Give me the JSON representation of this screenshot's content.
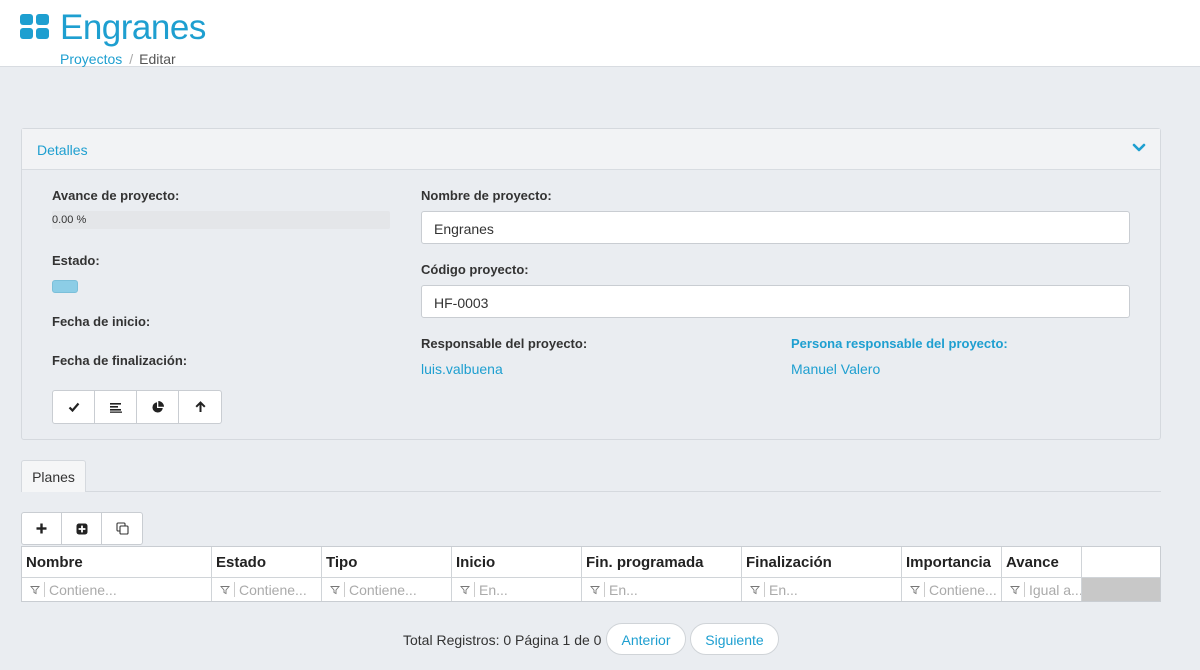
{
  "header": {
    "title": "Engranes",
    "breadcrumb": {
      "link": "Proyectos",
      "separator": "/",
      "current": "Editar"
    }
  },
  "details": {
    "panel_title": "Detalles",
    "avance_label": "Avance de proyecto:",
    "avance_value": "0.00 %",
    "avance_fraction": 0,
    "estado_label": "Estado:",
    "fecha_inicio_label": "Fecha de inicio:",
    "fecha_fin_label": "Fecha de finalización:",
    "nombre_label": "Nombre de proyecto:",
    "nombre_value": "Engranes",
    "codigo_label": "Código proyecto:",
    "codigo_value": "HF-0003",
    "responsable_label": "Responsable del proyecto:",
    "responsable_value": "luis.valbuena",
    "persona_label": "Persona responsable del proyecto:",
    "persona_value": "Manuel Valero",
    "action_icons": [
      "check-icon",
      "align-left-icon",
      "pie-chart-icon",
      "arrow-up-icon"
    ]
  },
  "tabs": [
    {
      "label": "Planes"
    }
  ],
  "toolbar_icons": [
    "plus-icon",
    "plus-square-icon",
    "copy-icon"
  ],
  "grid": {
    "columns": [
      {
        "header": "Nombre",
        "filter": "Contiene..."
      },
      {
        "header": "Estado",
        "filter": "Contiene..."
      },
      {
        "header": "Tipo",
        "filter": "Contiene..."
      },
      {
        "header": "Inicio",
        "filter": "En..."
      },
      {
        "header": "Fin. programada",
        "filter": "En..."
      },
      {
        "header": "Finalización",
        "filter": "En..."
      },
      {
        "header": "Importancia",
        "filter": "Contiene..."
      },
      {
        "header": "Avance",
        "filter": "Igual a..."
      }
    ]
  },
  "pager": {
    "summary": "Total Registros: 0 Página 1 de 0",
    "prev_label": "Anterior",
    "next_label": "Siguiente"
  },
  "colors": {
    "accent": "#1e9fd0",
    "status": "#8ccde6",
    "background": "#eaedf1"
  }
}
